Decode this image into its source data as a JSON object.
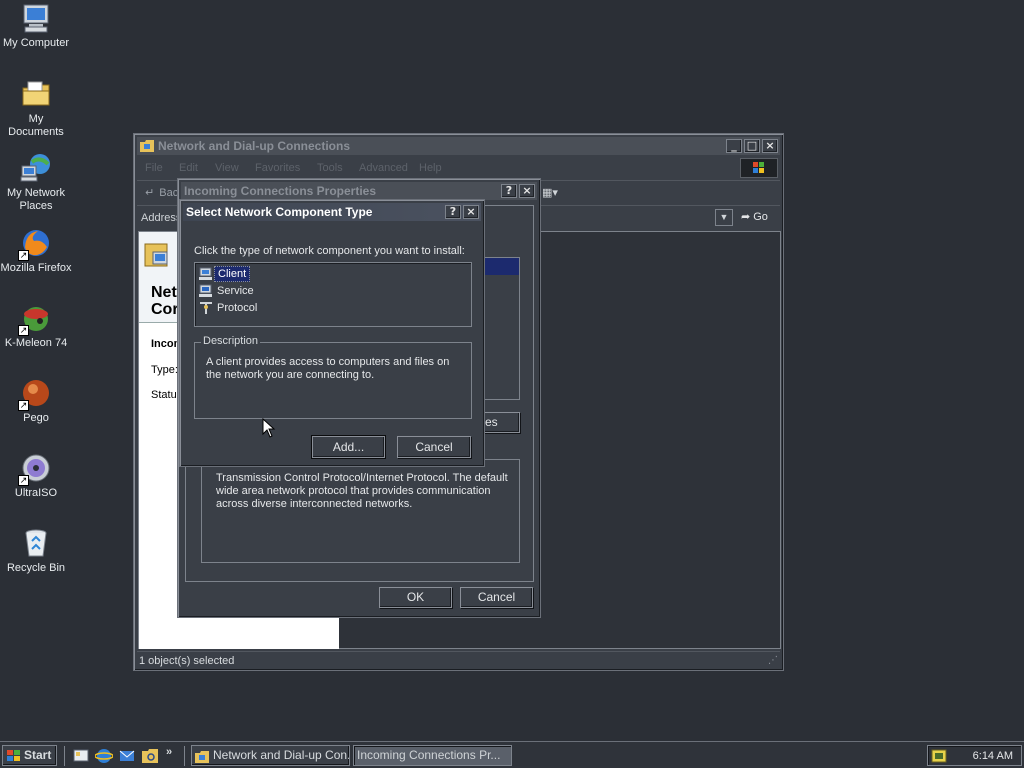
{
  "desktop": {
    "icons": [
      {
        "label": "My Computer"
      },
      {
        "label": "My Documents"
      },
      {
        "label": "My Network Places"
      },
      {
        "label": "Mozilla Firefox"
      },
      {
        "label": "K-Meleon 74"
      },
      {
        "label": "Pego"
      },
      {
        "label": "UltraISO"
      },
      {
        "label": "Recycle Bin"
      }
    ]
  },
  "explorer": {
    "title": "Network and Dial-up Connections",
    "menu": [
      "File",
      "Edit",
      "View",
      "Favorites",
      "Tools",
      "Advanced",
      "Help"
    ],
    "toolbar_back": "Back",
    "address_label": "Address",
    "go_label": "Go",
    "left_panel": {
      "heading_line1": "Net",
      "heading_line2": "Cor",
      "item_label": "Incom",
      "type_label": "Type:",
      "status_label": "Status"
    },
    "status_bar": "1 object(s) selected"
  },
  "incoming": {
    "title": "Incoming Connections Properties",
    "properties_button_partial": "es",
    "description": "Transmission Control Protocol/Internet Protocol. The default wide area network protocol that provides communication across diverse interconnected networks.",
    "ok_label": "OK",
    "cancel_label": "Cancel"
  },
  "dialog": {
    "title": "Select Network Component Type",
    "instruction": "Click the type of network component you want to install:",
    "items": [
      {
        "label": "Client",
        "selected": true
      },
      {
        "label": "Service",
        "selected": false
      },
      {
        "label": "Protocol",
        "selected": false
      }
    ],
    "description_title": "Description",
    "description_text": "A client provides access to computers and files on the network you are connecting to.",
    "add_label": "Add...",
    "cancel_label": "Cancel"
  },
  "taskbar": {
    "start_label": "Start",
    "tasks": [
      {
        "label": "Network and Dial-up Con...",
        "pressed": false
      },
      {
        "label": "Incoming Connections Pr...",
        "pressed": true
      }
    ],
    "clock": "6:14 AM"
  },
  "colors": {
    "desktop": "#2b2f36",
    "selection": "#1c2a6e",
    "window": "#3a3f47"
  }
}
